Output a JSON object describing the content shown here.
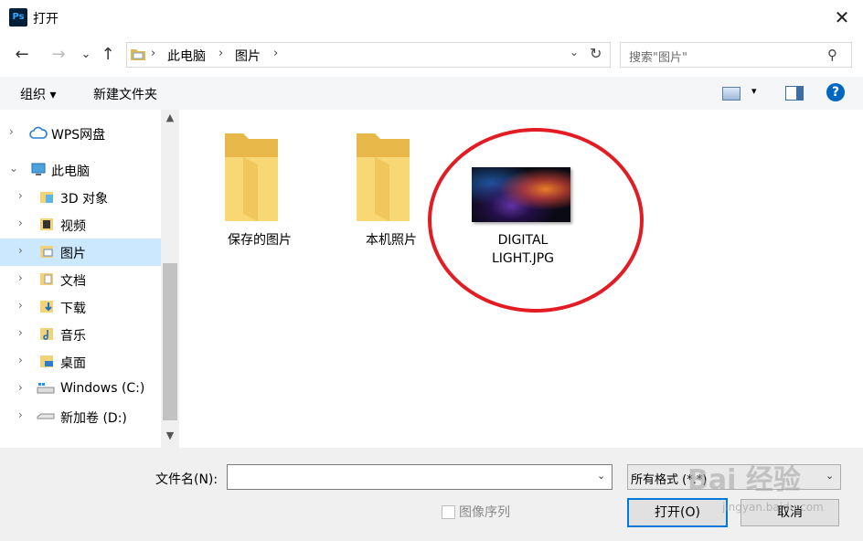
{
  "window": {
    "title": "打开",
    "app_icon": "Ps",
    "close_glyph": "✕"
  },
  "nav": {
    "back_glyph": "←",
    "forward_glyph": "→",
    "recent_glyph": "⌄",
    "up_glyph": "↑",
    "breadcrumbs": [
      "此电脑",
      "图片"
    ],
    "sep_glyph": "›",
    "dropdown_glyph": "⌄",
    "refresh_glyph": "↻",
    "search_placeholder": "搜索\"图片\"",
    "search_glyph": "⚲"
  },
  "toolbar": {
    "organize": "组织 ▾",
    "new_folder": "新建文件夹",
    "view_dd": "▾",
    "help": "?"
  },
  "sidebar": {
    "items": [
      {
        "label": "WPS网盘",
        "icon": "cloud-icon",
        "chev": "›"
      },
      {
        "label": "此电脑",
        "icon": "computer-icon",
        "chev": "⌄"
      },
      {
        "label": "3D 对象",
        "icon": "3d-objects-icon",
        "chev": "›"
      },
      {
        "label": "视频",
        "icon": "video-folder-icon",
        "chev": "›"
      },
      {
        "label": "图片",
        "icon": "pictures-folder-icon",
        "chev": "›",
        "selected": true
      },
      {
        "label": "文档",
        "icon": "documents-folder-icon",
        "chev": "›"
      },
      {
        "label": "下载",
        "icon": "downloads-folder-icon",
        "chev": "›"
      },
      {
        "label": "音乐",
        "icon": "music-folder-icon",
        "chev": "›"
      },
      {
        "label": "桌面",
        "icon": "desktop-folder-icon",
        "chev": "›"
      },
      {
        "label": "Windows (C:)",
        "icon": "drive-c-icon",
        "chev": "›"
      },
      {
        "label": "新加卷 (D:)",
        "icon": "drive-d-icon",
        "chev": "›"
      }
    ],
    "scroll_up": "▲",
    "scroll_down": "▼"
  },
  "files": [
    {
      "name": "保存的图片",
      "type": "folder"
    },
    {
      "name": "本机照片",
      "type": "folder"
    },
    {
      "name": "DIGITAL\nLIGHT.JPG",
      "type": "image"
    }
  ],
  "footer": {
    "filename_label": "文件名(N):",
    "filename_value": "",
    "filetype_value": "所有格式 (*.*)",
    "dd_glyph": "⌄",
    "sequence_label": "图像序列",
    "open_button": "打开(O)",
    "cancel_button": "取消"
  },
  "watermark": {
    "logo": "Bai 经验",
    "url": "jingyan.baidu.com"
  },
  "colors": {
    "selection": "#cce8ff",
    "accent": "#0078d7",
    "highlight_circle": "#e31c24",
    "folder": "#f8d775"
  }
}
